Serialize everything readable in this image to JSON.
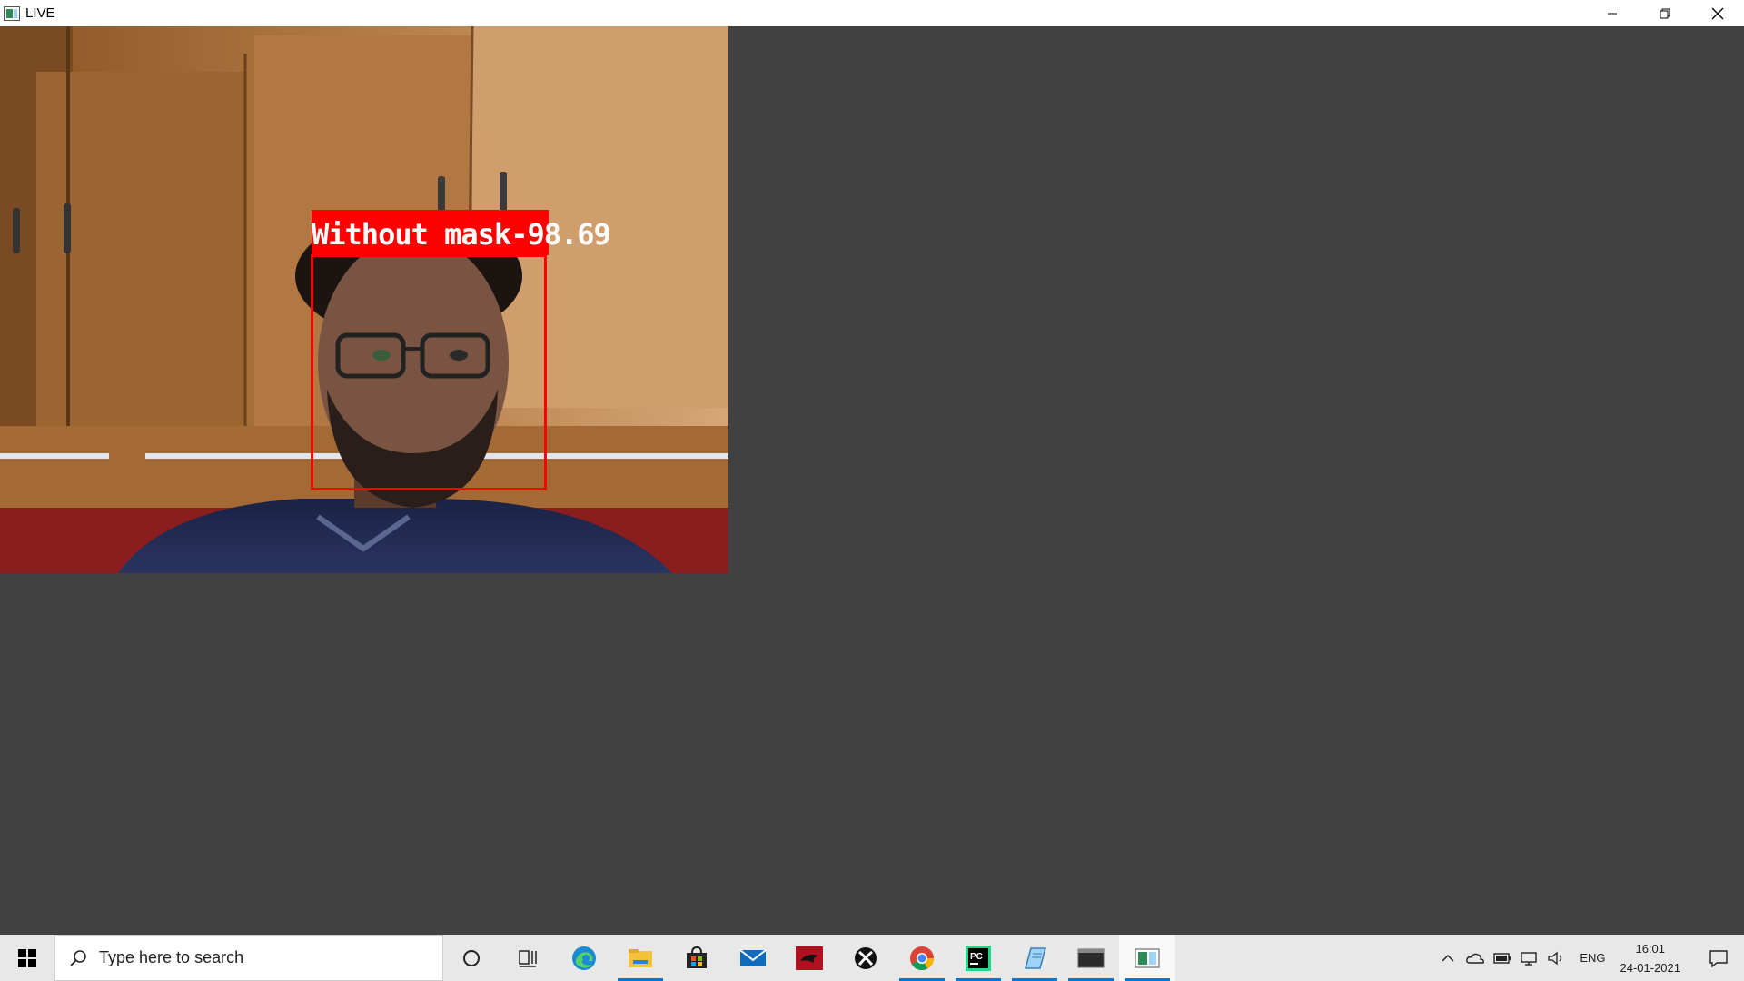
{
  "window": {
    "title": "LIVE"
  },
  "video": {
    "detection_label": "Without mask-98.69",
    "box_color": "#ff0000"
  },
  "taskbar": {
    "search_placeholder": "Type here to search",
    "apps": [
      {
        "icon": "cortana-icon"
      },
      {
        "icon": "task-view-icon"
      },
      {
        "icon": "edge-icon"
      },
      {
        "icon": "file-explorer-icon"
      },
      {
        "icon": "store-icon"
      },
      {
        "icon": "mail-icon"
      },
      {
        "icon": "red-app-icon"
      },
      {
        "icon": "xbox-icon"
      },
      {
        "icon": "chrome-icon"
      },
      {
        "icon": "pycharm-icon"
      },
      {
        "icon": "notepad-icon"
      },
      {
        "icon": "terminal-icon"
      },
      {
        "icon": "live-window-icon"
      }
    ],
    "tray": {
      "language": "ENG",
      "time": "16:01",
      "date": "24-01-2021"
    }
  },
  "colors": {
    "background": "#414141",
    "accent": "#0078d7"
  }
}
